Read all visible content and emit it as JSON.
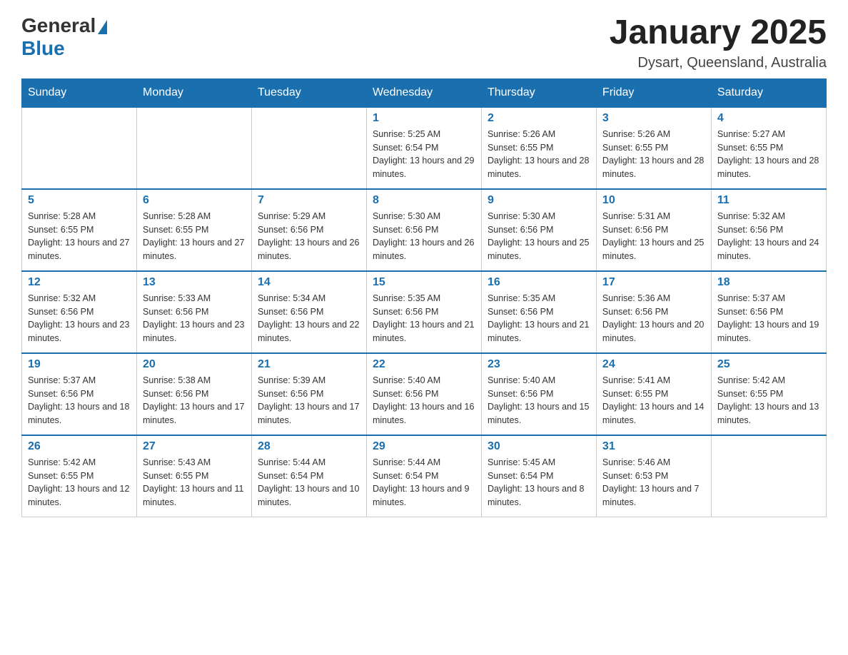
{
  "header": {
    "logo_general": "General",
    "logo_blue": "Blue",
    "title": "January 2025",
    "subtitle": "Dysart, Queensland, Australia"
  },
  "days_of_week": [
    "Sunday",
    "Monday",
    "Tuesday",
    "Wednesday",
    "Thursday",
    "Friday",
    "Saturday"
  ],
  "weeks": [
    [
      {
        "day": "",
        "info": ""
      },
      {
        "day": "",
        "info": ""
      },
      {
        "day": "",
        "info": ""
      },
      {
        "day": "1",
        "info": "Sunrise: 5:25 AM\nSunset: 6:54 PM\nDaylight: 13 hours and 29 minutes."
      },
      {
        "day": "2",
        "info": "Sunrise: 5:26 AM\nSunset: 6:55 PM\nDaylight: 13 hours and 28 minutes."
      },
      {
        "day": "3",
        "info": "Sunrise: 5:26 AM\nSunset: 6:55 PM\nDaylight: 13 hours and 28 minutes."
      },
      {
        "day": "4",
        "info": "Sunrise: 5:27 AM\nSunset: 6:55 PM\nDaylight: 13 hours and 28 minutes."
      }
    ],
    [
      {
        "day": "5",
        "info": "Sunrise: 5:28 AM\nSunset: 6:55 PM\nDaylight: 13 hours and 27 minutes."
      },
      {
        "day": "6",
        "info": "Sunrise: 5:28 AM\nSunset: 6:55 PM\nDaylight: 13 hours and 27 minutes."
      },
      {
        "day": "7",
        "info": "Sunrise: 5:29 AM\nSunset: 6:56 PM\nDaylight: 13 hours and 26 minutes."
      },
      {
        "day": "8",
        "info": "Sunrise: 5:30 AM\nSunset: 6:56 PM\nDaylight: 13 hours and 26 minutes."
      },
      {
        "day": "9",
        "info": "Sunrise: 5:30 AM\nSunset: 6:56 PM\nDaylight: 13 hours and 25 minutes."
      },
      {
        "day": "10",
        "info": "Sunrise: 5:31 AM\nSunset: 6:56 PM\nDaylight: 13 hours and 25 minutes."
      },
      {
        "day": "11",
        "info": "Sunrise: 5:32 AM\nSunset: 6:56 PM\nDaylight: 13 hours and 24 minutes."
      }
    ],
    [
      {
        "day": "12",
        "info": "Sunrise: 5:32 AM\nSunset: 6:56 PM\nDaylight: 13 hours and 23 minutes."
      },
      {
        "day": "13",
        "info": "Sunrise: 5:33 AM\nSunset: 6:56 PM\nDaylight: 13 hours and 23 minutes."
      },
      {
        "day": "14",
        "info": "Sunrise: 5:34 AM\nSunset: 6:56 PM\nDaylight: 13 hours and 22 minutes."
      },
      {
        "day": "15",
        "info": "Sunrise: 5:35 AM\nSunset: 6:56 PM\nDaylight: 13 hours and 21 minutes."
      },
      {
        "day": "16",
        "info": "Sunrise: 5:35 AM\nSunset: 6:56 PM\nDaylight: 13 hours and 21 minutes."
      },
      {
        "day": "17",
        "info": "Sunrise: 5:36 AM\nSunset: 6:56 PM\nDaylight: 13 hours and 20 minutes."
      },
      {
        "day": "18",
        "info": "Sunrise: 5:37 AM\nSunset: 6:56 PM\nDaylight: 13 hours and 19 minutes."
      }
    ],
    [
      {
        "day": "19",
        "info": "Sunrise: 5:37 AM\nSunset: 6:56 PM\nDaylight: 13 hours and 18 minutes."
      },
      {
        "day": "20",
        "info": "Sunrise: 5:38 AM\nSunset: 6:56 PM\nDaylight: 13 hours and 17 minutes."
      },
      {
        "day": "21",
        "info": "Sunrise: 5:39 AM\nSunset: 6:56 PM\nDaylight: 13 hours and 17 minutes."
      },
      {
        "day": "22",
        "info": "Sunrise: 5:40 AM\nSunset: 6:56 PM\nDaylight: 13 hours and 16 minutes."
      },
      {
        "day": "23",
        "info": "Sunrise: 5:40 AM\nSunset: 6:56 PM\nDaylight: 13 hours and 15 minutes."
      },
      {
        "day": "24",
        "info": "Sunrise: 5:41 AM\nSunset: 6:55 PM\nDaylight: 13 hours and 14 minutes."
      },
      {
        "day": "25",
        "info": "Sunrise: 5:42 AM\nSunset: 6:55 PM\nDaylight: 13 hours and 13 minutes."
      }
    ],
    [
      {
        "day": "26",
        "info": "Sunrise: 5:42 AM\nSunset: 6:55 PM\nDaylight: 13 hours and 12 minutes."
      },
      {
        "day": "27",
        "info": "Sunrise: 5:43 AM\nSunset: 6:55 PM\nDaylight: 13 hours and 11 minutes."
      },
      {
        "day": "28",
        "info": "Sunrise: 5:44 AM\nSunset: 6:54 PM\nDaylight: 13 hours and 10 minutes."
      },
      {
        "day": "29",
        "info": "Sunrise: 5:44 AM\nSunset: 6:54 PM\nDaylight: 13 hours and 9 minutes."
      },
      {
        "day": "30",
        "info": "Sunrise: 5:45 AM\nSunset: 6:54 PM\nDaylight: 13 hours and 8 minutes."
      },
      {
        "day": "31",
        "info": "Sunrise: 5:46 AM\nSunset: 6:53 PM\nDaylight: 13 hours and 7 minutes."
      },
      {
        "day": "",
        "info": ""
      }
    ]
  ]
}
